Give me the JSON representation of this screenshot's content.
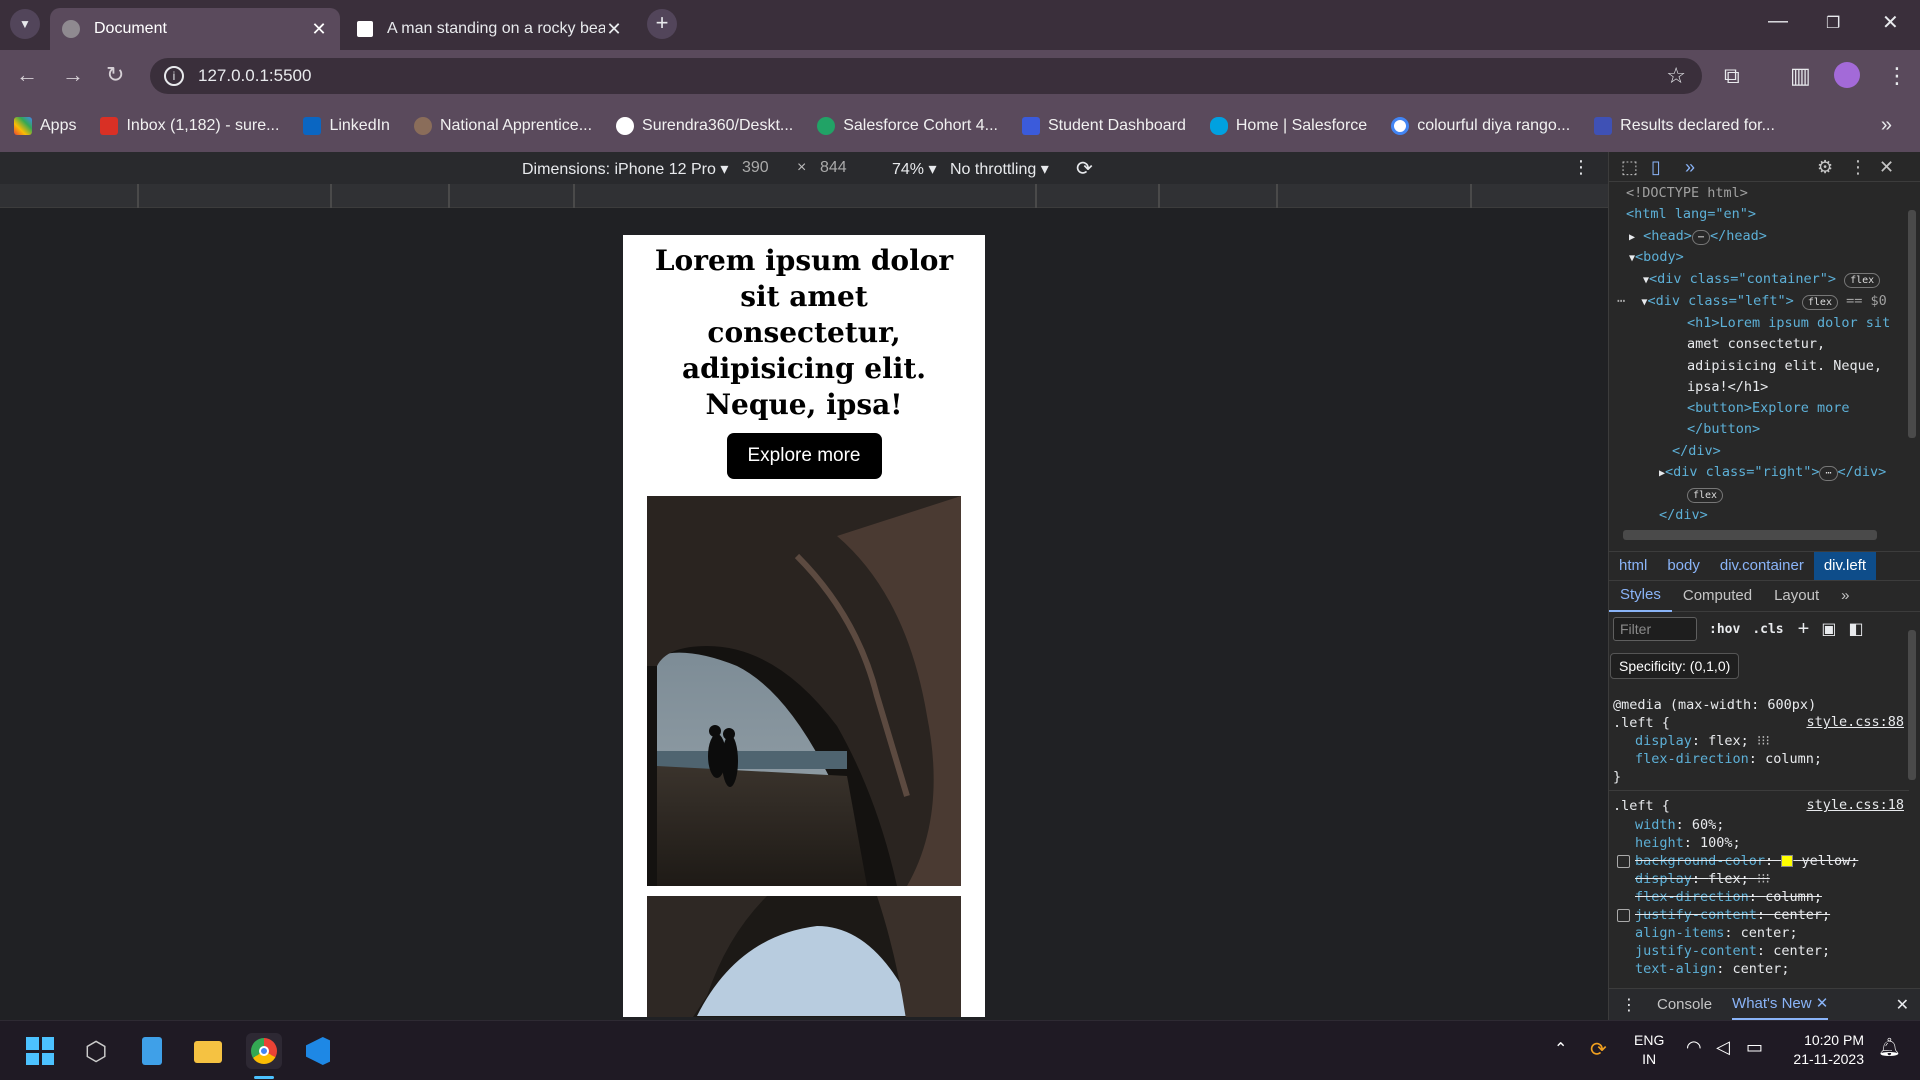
{
  "browser": {
    "tabs": [
      {
        "title": "Document",
        "active": true
      },
      {
        "title": "A man standing on a rocky beac",
        "active": false
      }
    ],
    "url": "127.0.0.1:5500",
    "bookmarks": [
      {
        "label": "Apps",
        "color": "#e94335"
      },
      {
        "label": "Inbox (1,182) - sure...",
        "color": "#d93025"
      },
      {
        "label": "LinkedIn",
        "color": "#0a66c2"
      },
      {
        "label": "National Apprentice...",
        "color": "#8a6d5a"
      },
      {
        "label": "Surendra360/Deskt...",
        "color": "#ffffff"
      },
      {
        "label": "Salesforce Cohort 4...",
        "color": "#21a366"
      },
      {
        "label": "Student Dashboard",
        "color": "#3b5bdb"
      },
      {
        "label": "Home | Salesforce",
        "color": "#00a1e0"
      },
      {
        "label": "colourful diya rango...",
        "color": "#4285f4"
      },
      {
        "label": "Results declared for...",
        "color": "#3f51b5"
      }
    ]
  },
  "device_toolbar": {
    "dimensions": "Dimensions: iPhone 12 Pro",
    "width": "390",
    "times": "×",
    "height": "844",
    "zoom": "74%",
    "throttling": "No throttling"
  },
  "page": {
    "heading": "Lorem ipsum dolor sit amet consectetur, adipisicing elit. Neque, ipsa!",
    "button": "Explore more"
  },
  "devtools": {
    "dom_lines": [
      "<!DOCTYPE html>",
      "<html lang=\"en\">",
      "<head>",
      "</head>",
      "<body>",
      "<div class=\"container\">",
      "<div class=\"left\">",
      "<h1>Lorem ipsum dolor sit",
      "amet consectetur,",
      "adipisicing elit. Neque,",
      "ipsa!</h1>",
      "<button>Explore more",
      "</button>",
      "</div>",
      "<div class=\"right\">",
      "</div>"
    ],
    "badges": {
      "flex": "flex",
      "eq": "== $0"
    },
    "breadcrumbs": [
      "html",
      "body",
      "div.container",
      "div.left"
    ],
    "panel_tabs": [
      "Styles",
      "Computed",
      "Layout"
    ],
    "filter_placeholder": "Filter",
    "hov": ":hov",
    "cls": ".cls",
    "tooltip": "Specificity: (0,1,0)",
    "media": "@media (max-width: 600px)",
    "rule1": {
      "selector": ".left {",
      "source": "style.css:88",
      "props": [
        {
          "name": "display",
          "value": "flex;"
        },
        {
          "name": "flex-direction",
          "value": "column;"
        }
      ],
      "close": "}"
    },
    "rule2": {
      "selector": ".left {",
      "source": "style.css:18",
      "props": [
        {
          "name": "width",
          "value": "60%;"
        },
        {
          "name": "height",
          "value": "100%;"
        },
        {
          "name": "background-color",
          "value": "yellow;",
          "struck": true
        },
        {
          "name": "display",
          "value": "flex;",
          "struck": true
        },
        {
          "name": "flex-direction",
          "value": "column;",
          "struck": true
        },
        {
          "name": "justify-content",
          "value": "center;",
          "struck": true
        },
        {
          "name": "align-items",
          "value": "center;"
        },
        {
          "name": "justify-content",
          "value": "center;"
        },
        {
          "name": "text-align",
          "value": "center;"
        }
      ]
    },
    "drawer_tabs": [
      "Console",
      "What's New"
    ]
  },
  "taskbar": {
    "lang": "ENG",
    "region": "IN",
    "time": "10:20 PM",
    "date": "21-11-2023"
  }
}
